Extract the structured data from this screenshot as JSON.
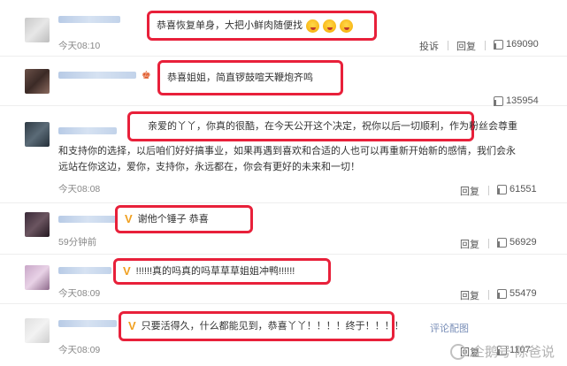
{
  "comments": [
    {
      "text": "恭喜恢复单身，大把小鲜肉随便找",
      "time": "今天08:10",
      "report": "投诉",
      "reply": "回复",
      "likes": "169090"
    },
    {
      "text": "恭喜姐姐，简直锣鼓喧天鞭炮齐鸣",
      "likes": "135954"
    },
    {
      "text_line1": "亲爱的丫丫，你真的很酷，在今天公开这个决定，祝你以后一切顺利，作为粉丝会尊重",
      "text_line2": "和支持你的选择，以后咱们好好搞事业，如果再遇到喜欢和合适的人也可以再重新开始新的感情，我们会永",
      "text_line3": "远站在你这边，爱你，支持你，永远都在，你会有更好的未来和一切！",
      "time": "今天08:08",
      "reply": "回复",
      "likes": "61551"
    },
    {
      "text": "谢他个锤子 恭喜",
      "time": "59分钟前",
      "reply": "回复",
      "likes": "56929"
    },
    {
      "text": "!!!!!!真的吗真的吗草草草姐姐冲鸭!!!!!!",
      "time": "今天08:09",
      "reply": "回复",
      "likes": "55479"
    },
    {
      "text": "只要活得久，什么都能见到，恭喜丫丫！！！！终于！！！！",
      "link": "评论配图",
      "time": "今天08:09",
      "reply": "回复",
      "likes": "1107"
    }
  ],
  "partial_time_top": "今天08:10",
  "vip_mark": "V",
  "watermark": "企鹅号 陈爸说"
}
